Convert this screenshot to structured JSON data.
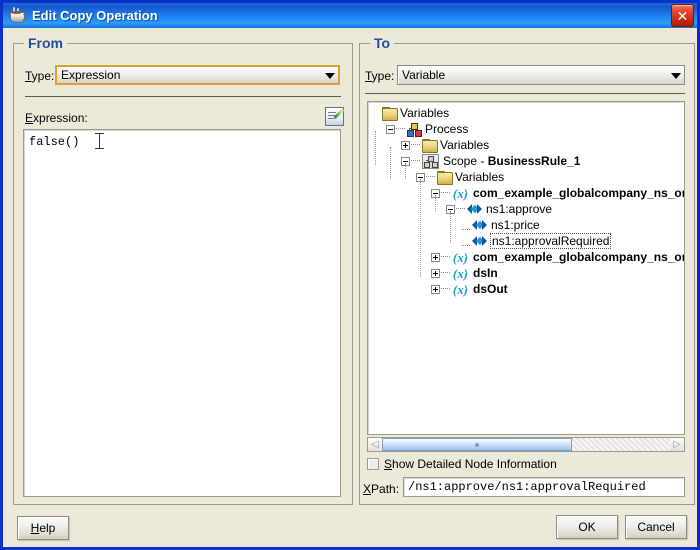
{
  "window": {
    "title": "Edit Copy Operation",
    "icon": "java-cup-icon",
    "close_label": "✕",
    "accent_title_bar": "#1f8cf6",
    "close_button_color": "#c62a10",
    "dialog_border_color": "#0b32c8",
    "background": "#ece9d8"
  },
  "from_panel": {
    "legend": "From",
    "type_label_pre": "T",
    "type_label_post": "ype:",
    "type_value": "Expression",
    "expression_label_pre": "E",
    "expression_label_post": "xpression:",
    "expression_value": "false()",
    "edit_icon": "edit-pencil-icon",
    "dropdown_arrow_icon": "chevron-down-icon"
  },
  "to_panel": {
    "legend": "To",
    "type_label_pre": "T",
    "type_label_post": "ype:",
    "type_value": "Variable",
    "dropdown_arrow_icon": "chevron-down-icon",
    "checkbox_label_pre": "S",
    "checkbox_label_post": "how Detailed Node Information",
    "checkbox_checked": false,
    "xpath_label_pre": "X",
    "xpath_label_post": "Path:",
    "xpath_value": "/ns1:approve/ns1:approvalRequired",
    "scroll_left_icon": "chevron-left-icon",
    "scroll_right_icon": "chevron-right-icon"
  },
  "tree": {
    "nodes": [
      {
        "label": "Variables",
        "icon": "folder-icon",
        "depth": 0,
        "toggle": "none",
        "bold": false,
        "selected": false
      },
      {
        "label": "Process",
        "icon": "process-icon",
        "depth": 1,
        "toggle": "minus",
        "bold": false,
        "selected": false
      },
      {
        "label": "Variables",
        "icon": "folder-icon",
        "depth": 2,
        "toggle": "plus",
        "bold": false,
        "selected": false
      },
      {
        "label": "Scope - ",
        "icon": "scope-icon",
        "depth": 2,
        "toggle": "minus",
        "bold": false,
        "selected": false,
        "bold_suffix": "BusinessRule_1"
      },
      {
        "label": "Variables",
        "icon": "folder-icon",
        "depth": 3,
        "toggle": "minus",
        "bold": false,
        "selected": false
      },
      {
        "label": "com_example_globalcompany_ns_or",
        "icon": "variable-icon",
        "depth": 4,
        "toggle": "minus",
        "bold": true,
        "selected": false
      },
      {
        "label": "ns1:approve",
        "icon": "element-icon",
        "depth": 5,
        "toggle": "minus",
        "bold": false,
        "selected": false
      },
      {
        "label": "ns1:price",
        "icon": "element-icon",
        "depth": 6,
        "toggle": "none",
        "bold": false,
        "selected": false
      },
      {
        "label": "ns1:approvalRequired",
        "icon": "element-icon",
        "depth": 6,
        "toggle": "none",
        "bold": false,
        "selected": true
      },
      {
        "label": "com_example_globalcompany_ns_or",
        "icon": "variable-icon",
        "depth": 4,
        "toggle": "plus",
        "bold": true,
        "selected": false
      },
      {
        "label": "dsIn",
        "icon": "variable-icon",
        "depth": 4,
        "toggle": "plus",
        "bold": true,
        "selected": false
      },
      {
        "label": "dsOut",
        "icon": "variable-icon",
        "depth": 4,
        "toggle": "plus",
        "bold": true,
        "selected": false
      }
    ]
  },
  "buttons": {
    "help_pre": "H",
    "help_post": "elp",
    "ok": "OK",
    "cancel": "Cancel"
  }
}
